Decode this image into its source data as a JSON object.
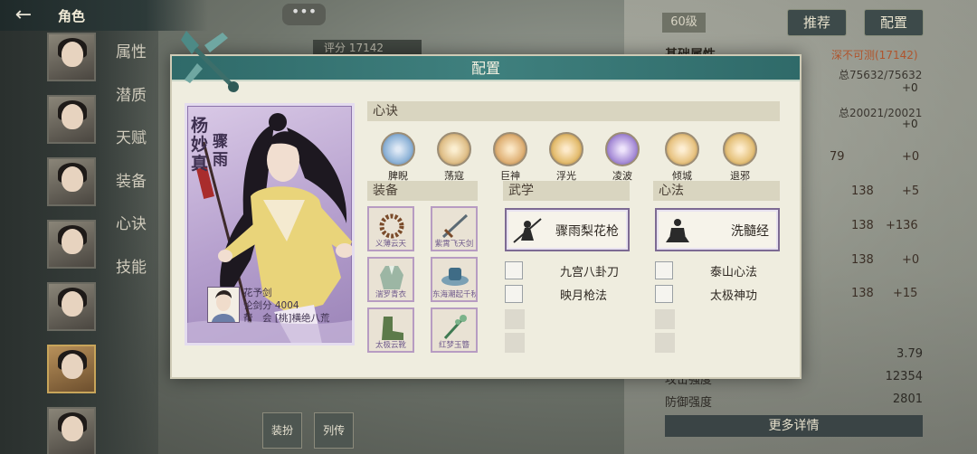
{
  "header": {
    "back_label": "←",
    "title": "角色"
  },
  "sidebar": {
    "tabs": [
      "属性",
      "潜质",
      "天赋",
      "装备",
      "心诀",
      "技能"
    ]
  },
  "top": {
    "level": "60级",
    "recommend_label": "推荐",
    "config_label": "配置",
    "chat_label": "•••",
    "score_label": "评分 17142"
  },
  "right_panel": {
    "section_title": "基础属性",
    "rank": "深不可测(17142)",
    "total1": "总75632/75632",
    "plus1": "+0",
    "total2": "总20021/20021",
    "plus2": "+0",
    "rows": [
      {
        "value": "79",
        "delta": "+0"
      },
      {
        "value": "138",
        "delta": "+5"
      },
      {
        "value": "138",
        "delta": "+136"
      },
      {
        "value": "138",
        "delta": "+0"
      },
      {
        "value": "138",
        "delta": "+15"
      }
    ],
    "stats": [
      {
        "label": "",
        "value": "3.79"
      },
      {
        "label": "攻击强度",
        "value": "12354"
      },
      {
        "label": "防御强度",
        "value": "2801"
      }
    ],
    "more_label": "更多详情"
  },
  "bottom_icons": [
    "装扮",
    "列传"
  ],
  "modal": {
    "title": "配置",
    "card": {
      "name": "杨妙真",
      "weapon": "骤雨",
      "player_name": "花予剑",
      "score": "论剑分 4004",
      "guild": "帮　会 [桃]横绝八荒"
    },
    "xinjue_title": "心诀",
    "xinjue": [
      {
        "label": "脾睨",
        "color": "#8fb4d8"
      },
      {
        "label": "荡寇",
        "color": "#e0c08a"
      },
      {
        "label": "巨神",
        "color": "#e0b277"
      },
      {
        "label": "浮光",
        "color": "#e4bd70"
      },
      {
        "label": "凌波",
        "color": "#a98fd8"
      },
      {
        "label": "倾城",
        "color": "#e8c483"
      },
      {
        "label": "退邪",
        "color": "#e5c17a"
      }
    ],
    "equip_title": "装备",
    "equip": [
      {
        "name": "义薄云天",
        "icon": "beads-icon"
      },
      {
        "name": "紫霄飞天剑",
        "icon": "sword-icon"
      },
      {
        "name": "湍罗青衣",
        "icon": "robe-icon"
      },
      {
        "name": "东海潮起千秋",
        "icon": "hat-icon"
      },
      {
        "name": "太极云靴",
        "icon": "boots-icon"
      },
      {
        "name": "红梦玉簪",
        "icon": "hairpin-icon"
      }
    ],
    "wuxue_title": "武学",
    "wuxue_main": "骤雨梨花枪",
    "wuxue_subs": [
      "九宫八卦刀",
      "映月枪法"
    ],
    "xinfa_title": "心法",
    "xinfa_main": "洗髓经",
    "xinfa_subs": [
      "泰山心法",
      "太极神功"
    ]
  }
}
